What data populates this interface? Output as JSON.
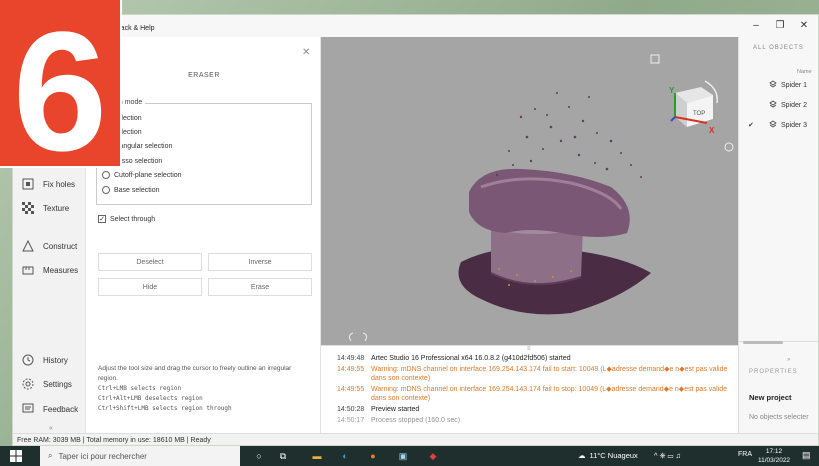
{
  "titlebar": {
    "menu_label": "edback & Help"
  },
  "leftnav": {
    "items": [
      {
        "label": "Fix holes",
        "icon": "fix-holes-icon"
      },
      {
        "label": "Texture",
        "icon": "texture-icon"
      },
      {
        "label": "Construct",
        "icon": "construct-icon"
      },
      {
        "label": "Measures",
        "icon": "measures-icon"
      },
      {
        "label": "History",
        "icon": "history-icon"
      },
      {
        "label": "Settings",
        "icon": "settings-icon"
      },
      {
        "label": "Feedback",
        "icon": "feedback-icon"
      }
    ],
    "collapse_label": "«"
  },
  "panel": {
    "title": "ERASER",
    "selection_mode_label": "ction mode",
    "options": [
      {
        "label": "selection",
        "selected": false
      },
      {
        "label": "selection",
        "selected": false
      },
      {
        "label": "ctangular selection",
        "selected": false
      },
      {
        "label": "Lasso selection",
        "selected": true
      },
      {
        "label": "Cutoff-plane selection",
        "selected": false
      },
      {
        "label": "Base selection",
        "selected": false
      }
    ],
    "select_through_label": "Select through",
    "select_through_checked": true,
    "buttons": {
      "deselect": "Deselect",
      "inverse": "Inverse",
      "hide": "Hide",
      "erase": "Erase"
    },
    "help": {
      "line1": "Adjust the tool size and drag the cursor to freely outline an irregular region.",
      "line2": "Ctrl+LMB selects region",
      "line3": "Ctrl+Alt+LMB deselects region",
      "line4": "Ctrl+Shift+LMB selects region through"
    }
  },
  "viewport": {
    "cube_label": "TOP",
    "axis_y": "Y",
    "axis_x": "X"
  },
  "rightpanel": {
    "header": "ALL OBJECTS",
    "col_name": "Name",
    "objects": [
      {
        "name": "Spider 1",
        "checked": false
      },
      {
        "name": "Spider 2",
        "checked": false
      },
      {
        "name": "Spider 3",
        "checked": true
      }
    ],
    "collapse": "»",
    "properties_header": "PROPERTIES",
    "project_title": "New project",
    "no_objects": "No objects selecter"
  },
  "log": {
    "lines": [
      {
        "time": "14:49:48",
        "msg": "Artec Studio 16 Professional x64 16.0.8.2 (g410d2fd506) started",
        "type": "info"
      },
      {
        "time": "14:49:55",
        "msg": "Warning: mDNS channel on interface 169.254.143.174 fail to start: 10049 (L◆adresse demand◆e n◆est pas valide dans son contexte)",
        "type": "warn"
      },
      {
        "time": "14:49:55",
        "msg": "Warning: mDNS channel on interface 169.254.143.174 fail to stop: 10049 (L◆adresse demand◆e n◆est pas valide dans son contexte)",
        "type": "warn"
      },
      {
        "time": "14:50:28",
        "msg": "Preview started",
        "type": "info"
      },
      {
        "time": "14:50:17",
        "msg": "Process stopped (160.0 sec)",
        "type": "info"
      }
    ]
  },
  "statusbar": {
    "text": "Free RAM: 3039 MB | Total memory in use: 18610 MB | Ready"
  },
  "badge": {
    "number": "6"
  },
  "taskbar": {
    "search_placeholder": "Taper ici pour rechercher",
    "weather": "11°C Nuageux",
    "lang": "FRA",
    "time": "17:12",
    "date": "11/03/2022"
  }
}
